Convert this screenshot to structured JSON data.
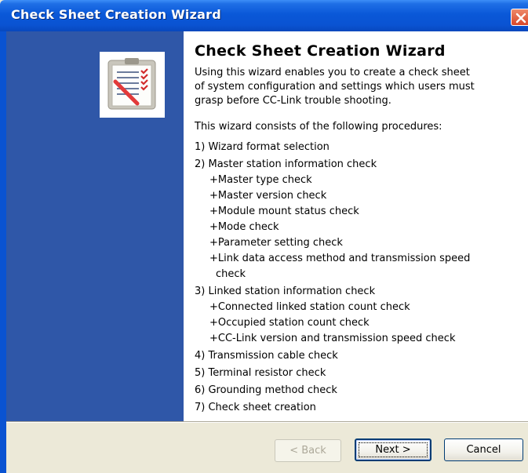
{
  "window": {
    "title": "Check Sheet Creation Wizard",
    "close_icon": "close-icon"
  },
  "colors": {
    "titlebar": "#0a53d2",
    "side_panel": "#2f57a8",
    "close_button": "#d8472a"
  },
  "content": {
    "heading": "Check Sheet Creation Wizard",
    "intro": "Using this wizard enables you to create a check sheet\nof system configuration and settings which users must\ngrasp before CC-Link trouble shooting.",
    "lead": "This wizard consists of the following procedures:",
    "steps": [
      {
        "label": "1) Wizard format selection",
        "subs": []
      },
      {
        "label": "2) Master station information check",
        "subs": [
          "+Master type check",
          "+Master version check",
          "+Module mount status check",
          "+Mode check",
          "+Parameter setting check",
          "+Link data access method and transmission speed",
          "check"
        ]
      },
      {
        "label": "3) Linked station information check",
        "subs": [
          "+Connected linked station count check",
          "+Occupied station count check",
          "+CC-Link version and transmission speed check"
        ]
      },
      {
        "label": "4) Transmission cable check",
        "subs": []
      },
      {
        "label": "5) Terminal resistor check",
        "subs": []
      },
      {
        "label": "6) Grounding method check",
        "subs": []
      },
      {
        "label": "7) Check sheet creation",
        "subs": []
      }
    ]
  },
  "buttons": {
    "back_label": "< Back",
    "next_label": "Next >",
    "cancel_label": "Cancel"
  },
  "icons": {
    "logo": "checklist-icon"
  }
}
